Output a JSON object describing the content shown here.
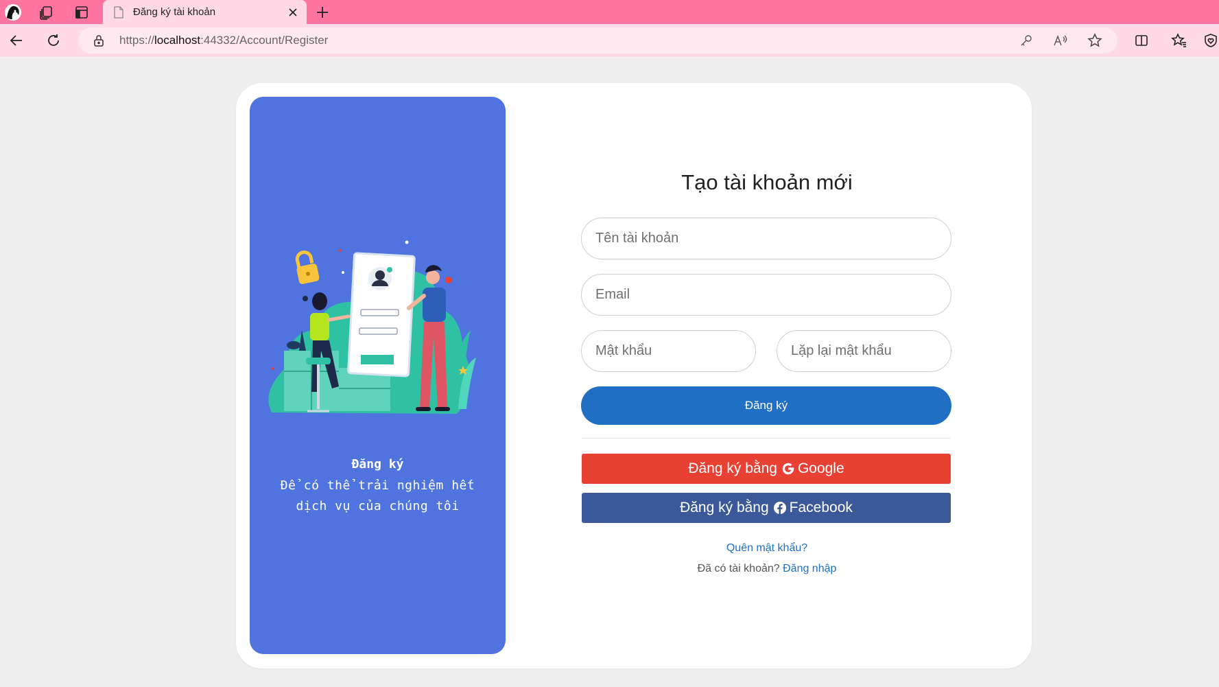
{
  "browser": {
    "tab_title": "Đăng ký tài khoản",
    "url_scheme": "https://",
    "url_host": "localhost",
    "url_path": ":44332/Account/Register"
  },
  "promo": {
    "title": "Đăng ký",
    "description": "Để có thể trải nghiệm hết dịch vụ của chúng tôi"
  },
  "form": {
    "title": "Tạo tài khoản mới",
    "username_placeholder": "Tên tài khoản",
    "email_placeholder": "Email",
    "password_placeholder": "Mật khẩu",
    "confirm_password_placeholder": "Lặp lại mật khẩu",
    "register_label": "Đăng ký",
    "google_prefix": "Đăng ký bằng",
    "google_label": "Google",
    "facebook_prefix": "Đăng ký bằng",
    "facebook_label": "Facebook",
    "forgot_password": "Quên mật khẩu?",
    "have_account": "Đã có tài khoản?",
    "login_link": "Đăng nhập"
  },
  "colors": {
    "tabbar": "#ff75a0",
    "toolbar": "#ffd9e6",
    "promo_panel": "#4f73df",
    "register_button": "#1f6fc5",
    "google_button": "#e84133",
    "facebook_button": "#3b5998"
  }
}
